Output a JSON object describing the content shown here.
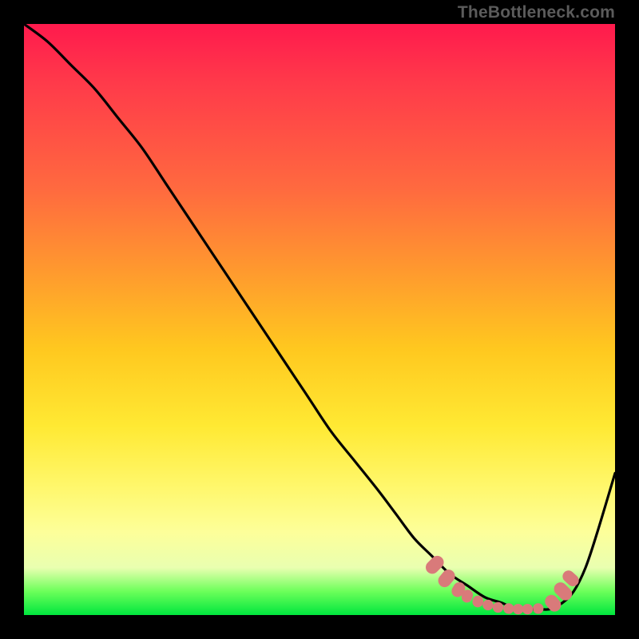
{
  "watermark": "TheBottleneck.com",
  "chart_data": {
    "type": "line",
    "title": "",
    "xlabel": "",
    "ylabel": "",
    "xlim": [
      0,
      100
    ],
    "ylim": [
      0,
      100
    ],
    "grid": false,
    "legend": false,
    "series": [
      {
        "name": "bottleneck-curve",
        "color": "#000000",
        "x": [
          0,
          4,
          8,
          12,
          16,
          20,
          24,
          28,
          32,
          36,
          40,
          44,
          48,
          52,
          56,
          60,
          63,
          66,
          69,
          72,
          75,
          78,
          81,
          83,
          85,
          87,
          89,
          91,
          93,
          95,
          97,
          100
        ],
        "values": [
          100,
          97,
          93,
          89,
          84,
          79,
          73,
          67,
          61,
          55,
          49,
          43,
          37,
          31,
          26,
          21,
          17,
          13,
          10,
          7,
          5,
          3,
          2,
          1,
          1,
          1,
          1,
          2,
          4,
          8,
          14,
          24
        ]
      }
    ],
    "markers": [
      {
        "name": "beads",
        "color": "#d97a7a",
        "shape": "rounded-rect",
        "points": [
          {
            "x": 69.5,
            "y": 8.5,
            "w": 2.2,
            "h": 3.4,
            "rot": 45
          },
          {
            "x": 71.5,
            "y": 6.2,
            "w": 2.2,
            "h": 3.2,
            "rot": 40
          },
          {
            "x": 73.5,
            "y": 4.3,
            "w": 2.0,
            "h": 2.6,
            "rot": 30
          },
          {
            "x": 75.0,
            "y": 3.2,
            "w": 1.8,
            "h": 2.2,
            "rot": 20
          },
          {
            "x": 76.8,
            "y": 2.3,
            "w": 1.8,
            "h": 2.0,
            "rot": 10
          },
          {
            "x": 78.5,
            "y": 1.7,
            "w": 1.8,
            "h": 1.8,
            "rot": 0
          },
          {
            "x": 80.2,
            "y": 1.3,
            "w": 1.8,
            "h": 1.8,
            "rot": 0
          },
          {
            "x": 82.0,
            "y": 1.1,
            "w": 1.8,
            "h": 1.8,
            "rot": 0
          },
          {
            "x": 83.6,
            "y": 1.0,
            "w": 1.8,
            "h": 1.8,
            "rot": 0
          },
          {
            "x": 85.2,
            "y": 1.0,
            "w": 1.8,
            "h": 1.8,
            "rot": 0
          },
          {
            "x": 87.0,
            "y": 1.1,
            "w": 1.8,
            "h": 1.8,
            "rot": 0
          },
          {
            "x": 89.5,
            "y": 2.0,
            "w": 2.2,
            "h": 3.0,
            "rot": -40
          },
          {
            "x": 91.2,
            "y": 4.0,
            "w": 2.2,
            "h": 3.4,
            "rot": -45
          },
          {
            "x": 92.5,
            "y": 6.2,
            "w": 2.0,
            "h": 3.0,
            "rot": -48
          }
        ]
      }
    ]
  }
}
